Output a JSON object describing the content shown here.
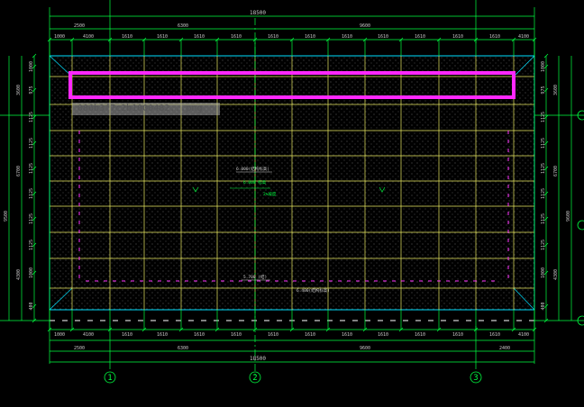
{
  "drawing": {
    "total_width": "18500",
    "top_sections": [
      "2500",
      "6300",
      "9600"
    ],
    "top_segments": [
      "1000",
      "4100",
      "1610",
      "1610",
      "1610",
      "1610",
      "1610",
      "1610",
      "1610",
      "1610",
      "1610",
      "1610",
      "1610",
      "4100",
      "1000"
    ],
    "bottom_segments": [
      "1000",
      "4100",
      "1610",
      "1610",
      "1610",
      "1610",
      "1610",
      "1610",
      "1610",
      "1610",
      "1610",
      "1610",
      "1610",
      "4100",
      "1000"
    ],
    "bottom_sections": [
      "2500",
      "6300",
      "9600",
      "2400"
    ],
    "left_segments": [
      "1000",
      "975",
      "1125",
      "1125",
      "1125",
      "1125",
      "1125",
      "1125",
      "1000",
      "400"
    ],
    "left_sections": [
      "3600",
      "6700",
      "4300",
      "9500"
    ],
    "right_segments": [
      "1000",
      "975",
      "1125",
      "1125",
      "1125",
      "1125",
      "1125",
      "1125",
      "1000",
      "400"
    ],
    "right_sections": [
      "3600",
      "6700",
      "4300",
      "9600"
    ],
    "axes": [
      "1",
      "2",
      "3"
    ],
    "annotations": {
      "elev_top": "6.000(结构标高)",
      "elev_mid": "6.000 标高",
      "slope": "2%坡度",
      "elev_low": "5.700 (结)",
      "elev_bottom": "6.400(结构标高)"
    }
  },
  "overlay": {
    "tooltip_text": "086b3f7c2b1000482...png",
    "highlight_color": "#ff28ff"
  },
  "colors": {
    "background": "#000000",
    "dimension_lines": "#00ff40",
    "grid_lines": "#ffff66",
    "outline": "#00e0ff",
    "edge_marks": "#ff33ff"
  }
}
